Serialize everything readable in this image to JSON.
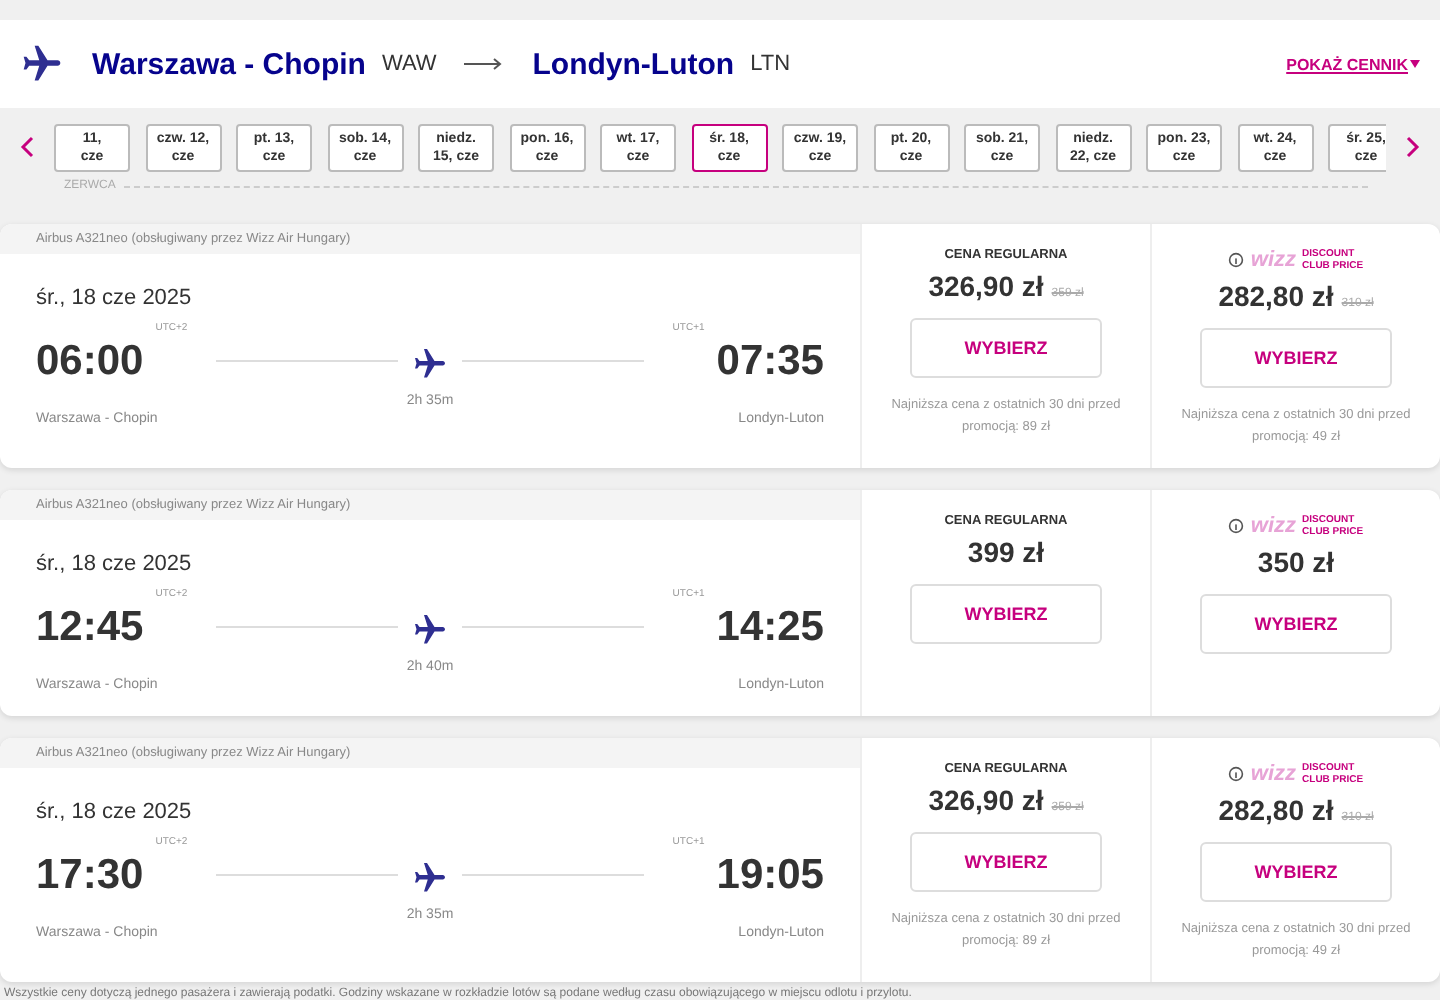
{
  "route": {
    "from": "Warszawa - Chopin",
    "from_code": "WAW",
    "to": "Londyn-Luton",
    "to_code": "LTN",
    "price_link": "POKAŻ CENNIK"
  },
  "dates": [
    {
      "lines": [
        "11,",
        "cze"
      ],
      "selected": false
    },
    {
      "lines": [
        "czw. 12,",
        "cze"
      ],
      "selected": false
    },
    {
      "lines": [
        "pt. 13,",
        "cze"
      ],
      "selected": false
    },
    {
      "lines": [
        "sob. 14,",
        "cze"
      ],
      "selected": false
    },
    {
      "lines": [
        "niedz.",
        "15, cze"
      ],
      "selected": false
    },
    {
      "lines": [
        "pon. 16,",
        "cze"
      ],
      "selected": false
    },
    {
      "lines": [
        "wt. 17,",
        "cze"
      ],
      "selected": false
    },
    {
      "lines": [
        "śr. 18,",
        "cze"
      ],
      "selected": true
    },
    {
      "lines": [
        "czw. 19,",
        "cze"
      ],
      "selected": false
    },
    {
      "lines": [
        "pt. 20,",
        "cze"
      ],
      "selected": false
    },
    {
      "lines": [
        "sob. 21,",
        "cze"
      ],
      "selected": false
    },
    {
      "lines": [
        "niedz.",
        "22, cze"
      ],
      "selected": false
    },
    {
      "lines": [
        "pon. 23,",
        "cze"
      ],
      "selected": false
    },
    {
      "lines": [
        "wt. 24,",
        "cze"
      ],
      "selected": false
    },
    {
      "lines": [
        "śr. 25,",
        "cze"
      ],
      "selected": false
    }
  ],
  "month": "ZERWCA",
  "flights": [
    {
      "aircraft": "Airbus A321neo (obsługiwany przez Wizz Air Hungary)",
      "date": "śr., 18 cze 2025",
      "dep_time": "06:00",
      "dep_tz": "UTC+2",
      "arr_time": "07:35",
      "arr_tz": "UTC+1",
      "dep_airport": "Warszawa - Chopin",
      "arr_airport": "Londyn-Luton",
      "duration": "2h 35m",
      "regular": {
        "label": "CENA REGULARNA",
        "price": "326,90 zł",
        "old_price": "359 zł",
        "button": "WYBIERZ",
        "note": "Najniższa cena z ostatnich 30 dni przed promocją: 89 zł"
      },
      "club": {
        "logo": "wizz",
        "logo_lines": [
          "DISCOUNT",
          "CLUB PRICE"
        ],
        "price": "282,80 zł",
        "old_price": "310 zł",
        "button": "WYBIERZ",
        "note": "Najniższa cena z ostatnich 30 dni przed promocją: 49 zł"
      }
    },
    {
      "aircraft": "Airbus A321neo (obsługiwany przez Wizz Air Hungary)",
      "date": "śr., 18 cze 2025",
      "dep_time": "12:45",
      "dep_tz": "UTC+2",
      "arr_time": "14:25",
      "arr_tz": "UTC+1",
      "dep_airport": "Warszawa - Chopin",
      "arr_airport": "Londyn-Luton",
      "duration": "2h 40m",
      "regular": {
        "label": "CENA REGULARNA",
        "price": "399 zł",
        "button": "WYBIERZ"
      },
      "club": {
        "logo": "wizz",
        "logo_lines": [
          "DISCOUNT",
          "CLUB PRICE"
        ],
        "price": "350 zł",
        "button": "WYBIERZ"
      }
    },
    {
      "aircraft": "Airbus A321neo (obsługiwany przez Wizz Air Hungary)",
      "date": "śr., 18 cze 2025",
      "dep_time": "17:30",
      "dep_tz": "UTC+2",
      "arr_time": "19:05",
      "arr_tz": "UTC+1",
      "dep_airport": "Warszawa - Chopin",
      "arr_airport": "Londyn-Luton",
      "duration": "2h 35m",
      "regular": {
        "label": "CENA REGULARNA",
        "price": "326,90 zł",
        "old_price": "359 zł",
        "button": "WYBIERZ",
        "note": "Najniższa cena z ostatnich 30 dni przed promocją: 89 zł"
      },
      "club": {
        "logo": "wizz",
        "logo_lines": [
          "DISCOUNT",
          "CLUB PRICE"
        ],
        "price": "282,80 zł",
        "old_price": "310 zł",
        "button": "WYBIERZ",
        "note": "Najniższa cena z ostatnich 30 dni przed promocją: 49 zł"
      }
    }
  ],
  "footer": "Wszystkie ceny dotyczą jednego pasażera i zawierają podatki. Godziny wskazane w rozkładzie lotów są podane według czasu obowiązującego w miejscu odlotu i przylotu."
}
